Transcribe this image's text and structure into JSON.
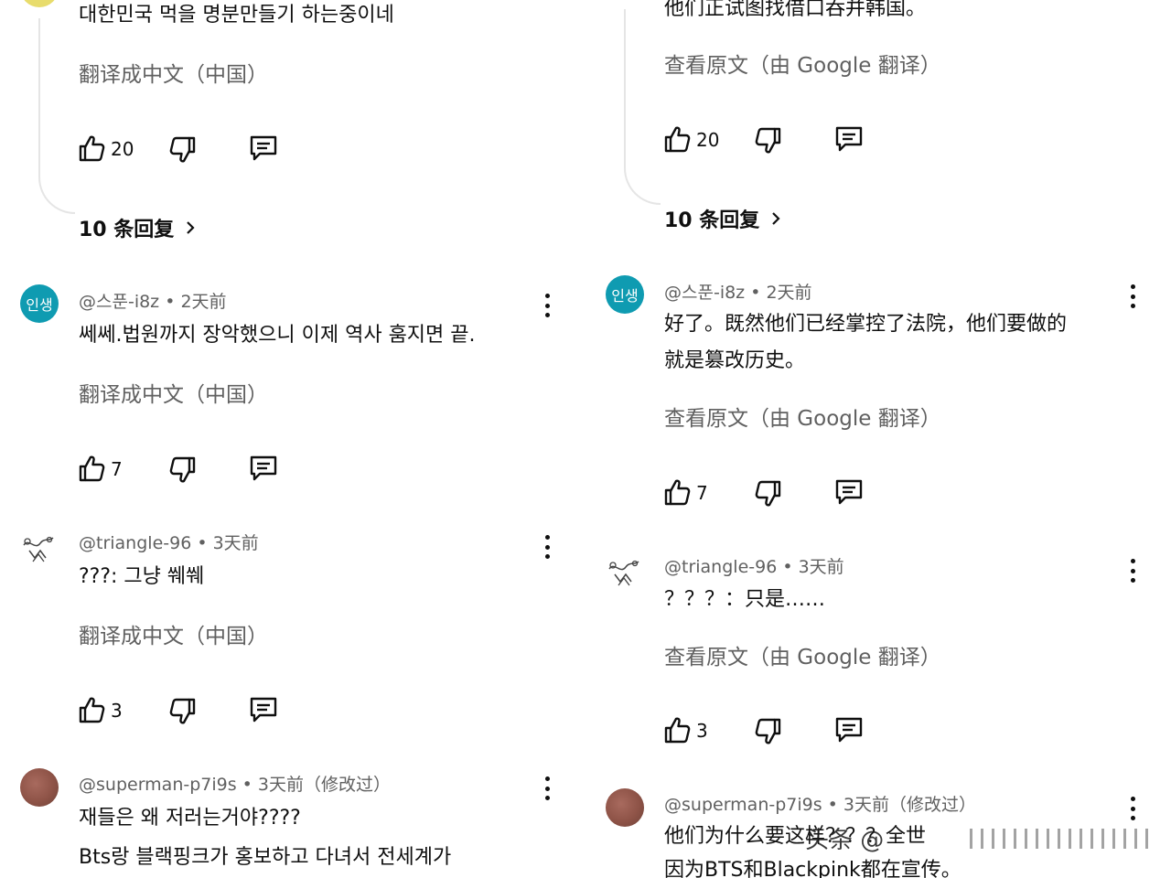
{
  "left": {
    "top_comment": {
      "text": "대한민국 먹을 명분만들기 하는중이네",
      "translate": "翻译成中文（中国）",
      "likes": "20",
      "replies": "10 条回复"
    },
    "comments": [
      {
        "avatar_text": "인생",
        "meta": "@스푼-i8z • 2天前",
        "lines": [
          "쎄쎄.법원까지 장악했으니 이제 역사 훔지면 끝."
        ],
        "translate": "翻译成中文（中国）",
        "likes": "7"
      },
      {
        "avatar_text": "",
        "meta": "@triangle-96 • 3天前",
        "lines": [
          "???: 그냥 쒜쒜"
        ],
        "translate": "翻译成中文（中国）",
        "likes": "3"
      },
      {
        "avatar_text": "",
        "meta": "@superman-p7i9s • 3天前（修改过）",
        "lines": [
          "재들은 왜 저러는거야????",
          "Bts랑  블랙핑크가 홍보하고 다녀서  전세계가"
        ]
      }
    ]
  },
  "right": {
    "top_comment": {
      "text": "他们正试图找借口吞并韩国。",
      "translate": "查看原文（由 Google 翻译）",
      "likes": "20",
      "replies": "10 条回复"
    },
    "comments": [
      {
        "avatar_text": "인생",
        "meta": "@스푼-i8z • 2天前",
        "lines": [
          "好了。既然他们已经掌控了法院，他们要做的",
          "就是篡改历史。"
        ],
        "translate": "查看原文（由 Google 翻译）",
        "likes": "7"
      },
      {
        "avatar_text": "",
        "meta": "@triangle-96 • 3天前",
        "lines": [
          "？？？：只是……"
        ],
        "translate": "查看原文（由 Google 翻译）",
        "likes": "3"
      },
      {
        "avatar_text": "",
        "meta": "@superman-p7i9s • 3天前（修改过）",
        "lines": [
          "他们为什么要这样？？？全世",
          "因为BTS和Blackpink都在宣传。"
        ]
      }
    ]
  },
  "watermark": "头条 @"
}
